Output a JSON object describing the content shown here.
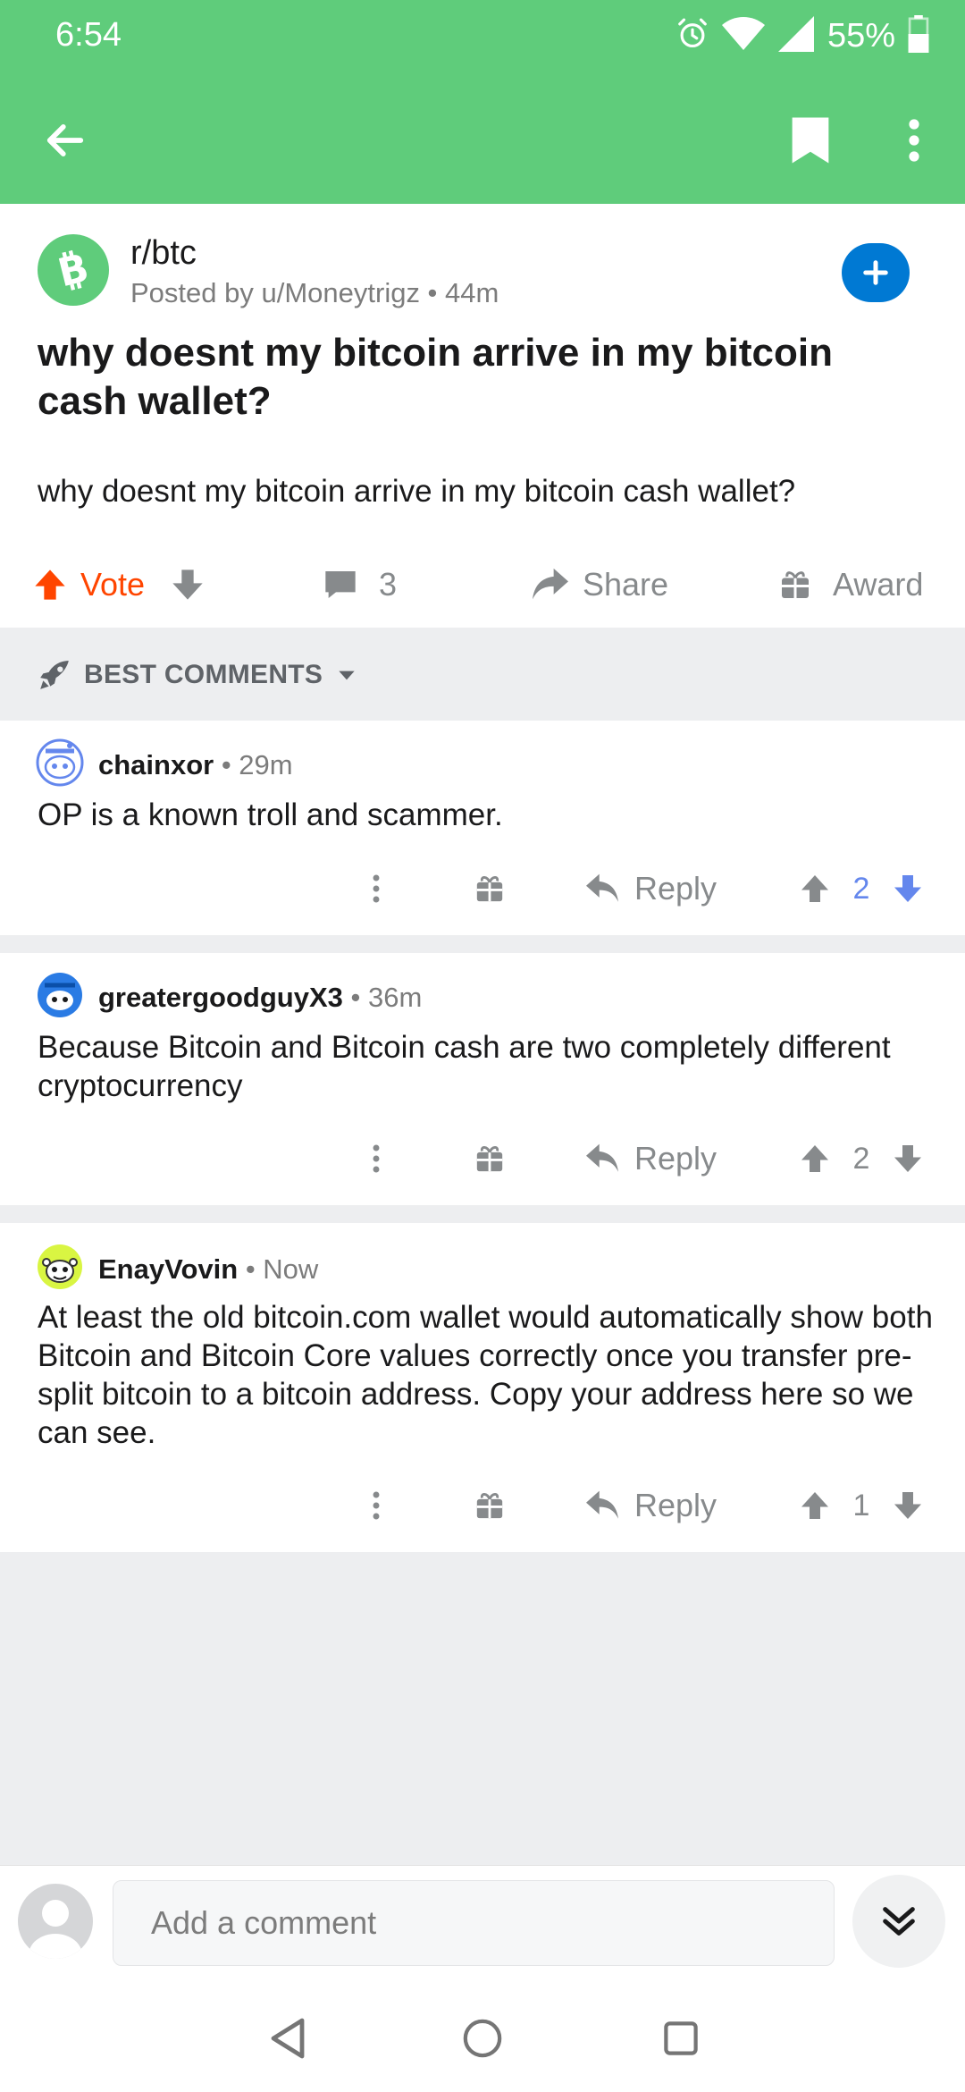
{
  "status_bar": {
    "time": "6:54",
    "battery": "55%",
    "icons": [
      "alarm-icon",
      "wifi-icon",
      "signal-icon",
      "battery-icon"
    ]
  },
  "app_bar": {
    "icons": [
      "back-arrow-icon",
      "bookmark-icon",
      "more-vertical-icon"
    ],
    "color": "#5fcc7b"
  },
  "post": {
    "subreddit": "r/btc",
    "meta": "Posted by u/Moneytrigz • 44m",
    "title": "why doesnt my bitcoin arrive in my bitcoin cash wallet?",
    "body": "why doesnt my bitcoin arrive in my bitcoin cash wallet?",
    "actions": {
      "vote_label": "Vote",
      "comment_count": "3",
      "share_label": "Share",
      "award_label": "Award"
    },
    "vote_color": "#ff4500",
    "join_color": "#0079d3"
  },
  "sort": {
    "label": "BEST COMMENTS"
  },
  "comments": [
    {
      "author": "chainxor",
      "time": " • 29m",
      "body": "OP is a known troll and scammer.",
      "reply_label": "Reply",
      "score": "2",
      "downvoted": true
    },
    {
      "author": "greatergoodguyX3",
      "time": " • 36m",
      "body": "Because Bitcoin and Bitcoin cash are two completely different cryptocurrency",
      "reply_label": "Reply",
      "score": "2",
      "downvoted": false
    },
    {
      "author": "EnayVovin",
      "time": " • Now",
      "body": "At least the old bitcoin.com wallet would automatically show both Bitcoin and Bitcoin Core values correctly once you transfer pre-split bitcoin to a bitcoin address. Copy your address here so we can see.",
      "reply_label": "Reply",
      "score": "1",
      "downvoted": false
    }
  ],
  "compose": {
    "placeholder": "Add a comment"
  },
  "nav_bar": {
    "icons": [
      "nav-back-icon",
      "nav-home-icon",
      "nav-recents-icon"
    ]
  },
  "colors": {
    "accent_blue": "#6487ed",
    "text_gray": "#878a8c"
  }
}
